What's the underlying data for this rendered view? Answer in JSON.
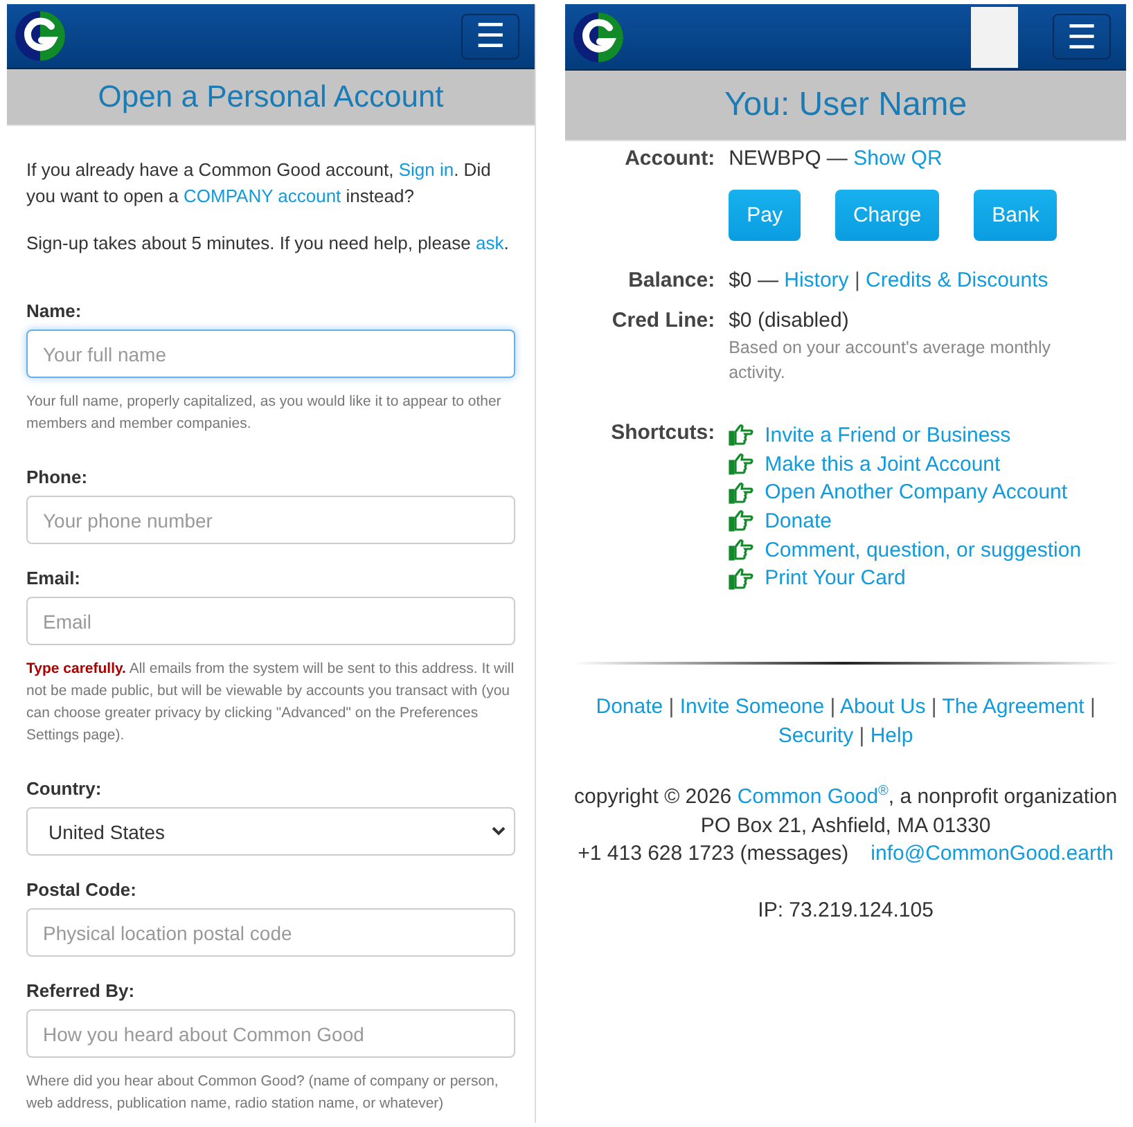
{
  "signup": {
    "header": {
      "menu_button": "☰"
    },
    "title": "Open a Personal Account",
    "intro": [
      [
        {
          "kind": "text",
          "text": "If you already have a Common Good account, "
        },
        {
          "kind": "link",
          "text": "Sign in"
        },
        {
          "kind": "text",
          "text": ". Did you want to open a "
        },
        {
          "kind": "link",
          "text": "COMPANY account"
        },
        {
          "kind": "text",
          "text": " instead?"
        }
      ],
      [
        {
          "kind": "text",
          "text": "Sign-up takes about 5 minutes. If you need help, please "
        },
        {
          "kind": "link",
          "text": "ask"
        },
        {
          "kind": "text",
          "text": "."
        }
      ]
    ],
    "fields": [
      {
        "kind": "input",
        "label": "Name:",
        "placeholder": "Your full name",
        "focused": true,
        "help": [
          {
            "kind": "text",
            "text": "Your full name, properly capitalized, as you would like it to appear to other members and member companies."
          }
        ]
      },
      {
        "kind": "input",
        "label": "Phone:",
        "placeholder": "Your phone number",
        "focused": false
      },
      {
        "kind": "input",
        "label": "Email:",
        "placeholder": "Email",
        "focused": false,
        "help": [
          {
            "kind": "warning",
            "text": "Type carefully."
          },
          {
            "kind": "text",
            "text": " All emails from the system will be sent to this address. It will not be made public, but will be viewable by accounts you transact with (you can choose greater privacy by clicking \"Advanced\" on the Preferences Settings page)."
          }
        ]
      },
      {
        "kind": "select",
        "label": "Country:",
        "value": "United States",
        "focused": false
      },
      {
        "kind": "input",
        "label": "Postal Code:",
        "placeholder": "Physical location postal code",
        "focused": false
      },
      {
        "kind": "input",
        "label": "Referred By:",
        "placeholder": "How you heard about Common Good",
        "focused": false,
        "help": [
          {
            "kind": "text",
            "text": "Where did you hear about Common Good? (name of company or person, web address, publication name, radio station name, or whatever)"
          }
        ]
      }
    ]
  },
  "account": {
    "header": {
      "menu_button": "☰"
    },
    "title": "You: User Name",
    "rows": [
      {
        "kind": "info",
        "label": "Account:",
        "value": "NEWBPQ —",
        "links": [
          "Show QR"
        ]
      },
      {
        "kind": "buttons",
        "buttons": [
          "Pay",
          "Charge",
          "Bank"
        ]
      },
      {
        "kind": "info",
        "label": "Balance:",
        "value": "$0 —",
        "links": [
          "History",
          "Credits & Discounts"
        ],
        "separator": "|"
      },
      {
        "kind": "info",
        "label": "Cred Line:",
        "value": "$0 (disabled)",
        "note": "Based on your account's average monthly activity."
      },
      {
        "kind": "shortcuts",
        "label": "Shortcuts:",
        "links": [
          "Invite a Friend or Business",
          "Make this a Joint Account",
          "Open Another Company Account",
          "Donate",
          "Comment, question, or suggestion",
          "Print Your Card"
        ]
      }
    ],
    "footer": {
      "links": [
        {
          "label": "Donate",
          "separator": "|"
        },
        {
          "label": "Invite Someone",
          "separator": "|"
        },
        {
          "label": "About Us",
          "separator": "|"
        },
        {
          "label": "The Agreement",
          "separator": "|"
        },
        {
          "label": "Security",
          "separator": "|"
        },
        {
          "label": "Help"
        }
      ],
      "copyright": [
        {
          "kind": "text",
          "text": "copyright © 2026 "
        },
        {
          "kind": "link",
          "text": "Common Good"
        },
        {
          "kind": "sup",
          "text": "®"
        },
        {
          "kind": "text",
          "text": ", a nonprofit organization"
        }
      ],
      "address": "PO Box 21, Ashfield, MA 01330",
      "phone": "+1 413 628 1723 (messages)",
      "email": "info@CommonGood.earth",
      "ip": "IP: 73.219.124.105"
    }
  }
}
